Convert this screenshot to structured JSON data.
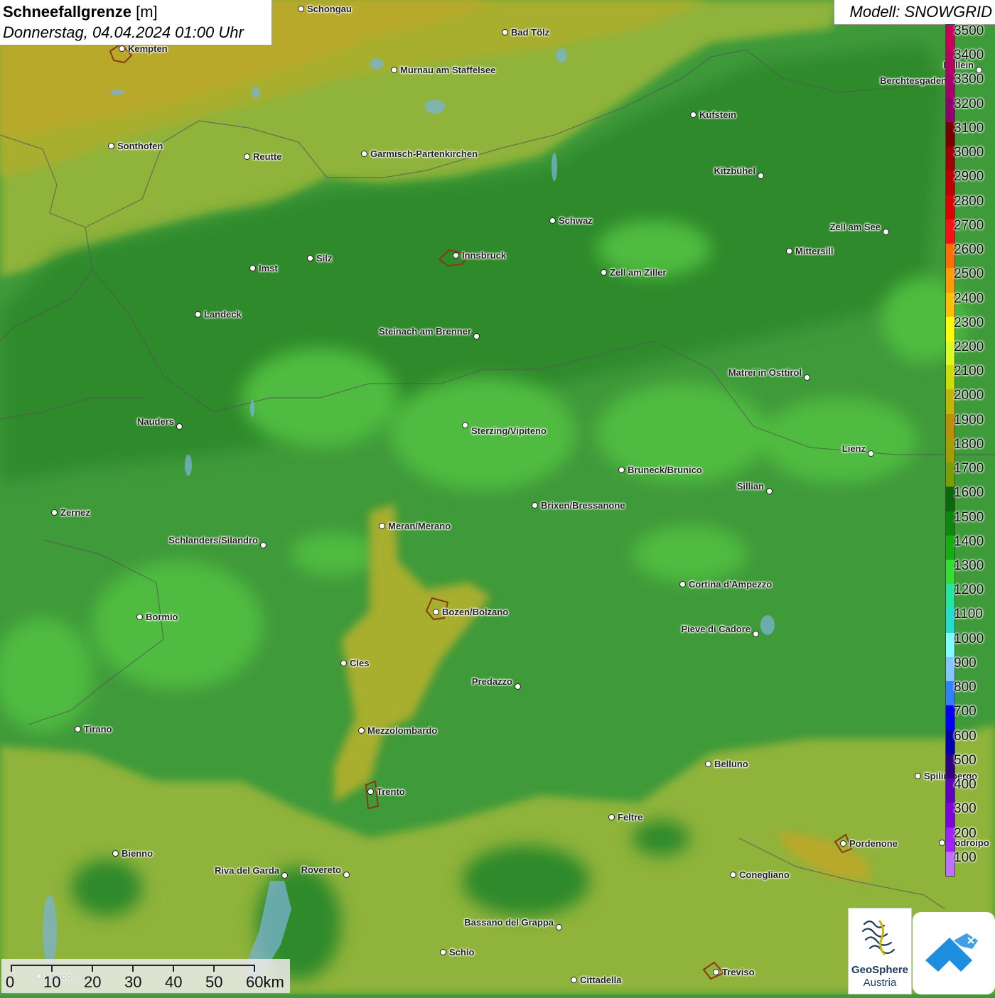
{
  "header": {
    "title_bold": "Schneefallgrenze",
    "title_unit": "[m]",
    "datetime": "Donnerstag, 04.04.2024 01:00 Uhr"
  },
  "model_label": "Modell: SNOWGRID",
  "legend": [
    {
      "label": "3500",
      "color": "#c8005a"
    },
    {
      "label": "3400",
      "color": "#b80060"
    },
    {
      "label": "3300",
      "color": "#a8006a"
    },
    {
      "label": "3200",
      "color": "#900070"
    },
    {
      "label": "3100",
      "color": "#7a0000"
    },
    {
      "label": "3000",
      "color": "#a00000"
    },
    {
      "label": "2900",
      "color": "#c00000"
    },
    {
      "label": "2800",
      "color": "#e00000"
    },
    {
      "label": "2700",
      "color": "#ff1010"
    },
    {
      "label": "2600",
      "color": "#ff7000"
    },
    {
      "label": "2500",
      "color": "#ff9a00"
    },
    {
      "label": "2400",
      "color": "#ffc000"
    },
    {
      "label": "2300",
      "color": "#ffff00"
    },
    {
      "label": "2200",
      "color": "#d8ff20"
    },
    {
      "label": "2100",
      "color": "#c8e000"
    },
    {
      "label": "2000",
      "color": "#c0b800"
    },
    {
      "label": "1900",
      "color": "#b89000"
    },
    {
      "label": "1800",
      "color": "#a0a000"
    },
    {
      "label": "1700",
      "color": "#78a000"
    },
    {
      "label": "1600",
      "color": "#0a6a0a"
    },
    {
      "label": "1500",
      "color": "#0a8a0a"
    },
    {
      "label": "1400",
      "color": "#10b010"
    },
    {
      "label": "1300",
      "color": "#30e030"
    },
    {
      "label": "1200",
      "color": "#20e8a0"
    },
    {
      "label": "1100",
      "color": "#20e0c8"
    },
    {
      "label": "1000",
      "color": "#80ffff"
    },
    {
      "label": "900",
      "color": "#80c8ff"
    },
    {
      "label": "800",
      "color": "#3080ff"
    },
    {
      "label": "700",
      "color": "#0000ff"
    },
    {
      "label": "600",
      "color": "#0000b0"
    },
    {
      "label": "500",
      "color": "#300080"
    },
    {
      "label": "400",
      "color": "#6000c0"
    },
    {
      "label": "300",
      "color": "#8000e0"
    },
    {
      "label": "200",
      "color": "#a020ff"
    },
    {
      "label": "100",
      "color": "#c070ff"
    }
  ],
  "cities": [
    {
      "name": "Schongau"
    },
    {
      "name": "Bad Tölz"
    },
    {
      "name": "Kempten"
    },
    {
      "name": "Murnau am Staffelsee"
    },
    {
      "name": "Hallein"
    },
    {
      "name": "Berchtesgaden"
    },
    {
      "name": "Kufstein"
    },
    {
      "name": "Sonthofen"
    },
    {
      "name": "Reutte"
    },
    {
      "name": "Garmisch-Partenkirchen"
    },
    {
      "name": "Kitzbühel"
    },
    {
      "name": "Schwaz"
    },
    {
      "name": "Zell am See"
    },
    {
      "name": "Innsbruck"
    },
    {
      "name": "Mittersill"
    },
    {
      "name": "Imst"
    },
    {
      "name": "Silz"
    },
    {
      "name": "Zell am Ziller"
    },
    {
      "name": "Landeck"
    },
    {
      "name": "Steinach am Brenner"
    },
    {
      "name": "Matrei in Osttirol"
    },
    {
      "name": "Nauders"
    },
    {
      "name": "Sterzing/Vipiteno"
    },
    {
      "name": "Lienz"
    },
    {
      "name": "Bruneck/Brunico"
    },
    {
      "name": "Sillian"
    },
    {
      "name": "Brixen/Bressanone"
    },
    {
      "name": "Zernez"
    },
    {
      "name": "Meran/Merano"
    },
    {
      "name": "Schlanders/Silandro"
    },
    {
      "name": "Cortina d'Ampezzo"
    },
    {
      "name": "Bozen/Bolzano"
    },
    {
      "name": "Bormio"
    },
    {
      "name": "Pieve di Cadore"
    },
    {
      "name": "Cles"
    },
    {
      "name": "Predazzo"
    },
    {
      "name": "Tirano"
    },
    {
      "name": "Mezzolombardo"
    },
    {
      "name": "Belluno"
    },
    {
      "name": "Spilimbergo"
    },
    {
      "name": "Trento"
    },
    {
      "name": "Feltre"
    },
    {
      "name": "Pordenone"
    },
    {
      "name": "Codroipo"
    },
    {
      "name": "Bienno"
    },
    {
      "name": "Riva del Garda"
    },
    {
      "name": "Rovereto"
    },
    {
      "name": "Conegliano"
    },
    {
      "name": "Bassano del Grappa"
    },
    {
      "name": "Schio"
    },
    {
      "name": "Lecco"
    },
    {
      "name": "Treviso"
    },
    {
      "name": "Cittadella"
    }
  ],
  "scalebar": {
    "labels": [
      "0",
      "10",
      "20",
      "30",
      "40",
      "50",
      "60km"
    ]
  },
  "logo": {
    "name1": "GeoSphere",
    "name2": "Austria"
  }
}
